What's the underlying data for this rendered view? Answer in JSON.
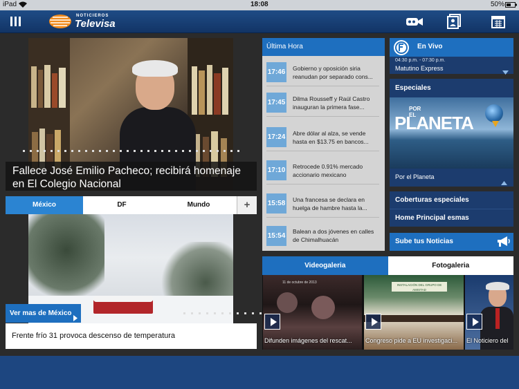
{
  "status": {
    "carrier": "iPad",
    "time": "18:08",
    "battery": "50%"
  },
  "brand": {
    "line1": "NOTICIEROS",
    "line2": "Televisa"
  },
  "hero": {
    "title": "Fallece José Emilio Pacheco; recibirá homenaje en El Colegio Nacional"
  },
  "sections": {
    "tabs": [
      "México",
      "DF",
      "Mundo"
    ],
    "add": "+"
  },
  "mexico": {
    "more": "Ver mas de México",
    "story": "Frente frío 31 provoca descenso de temperatura"
  },
  "ultima": {
    "title": "Última Hora",
    "items": [
      {
        "time": "17:46",
        "text": "Gobierno y oposición siria reanudan por separado cons..."
      },
      {
        "time": "17:45",
        "text": "Dilma Rousseff y Raúl Castro inauguran la primera fase..."
      },
      {
        "time": "17:24",
        "text": "Abre dólar al alza, se vende hasta en $13.75 en bancos..."
      },
      {
        "time": "17:10",
        "text": "Retrocede 0.91% mercado accionario mexicano"
      },
      {
        "time": "15:58",
        "text": "Una francesa se declara en huelga de hambre hasta la..."
      },
      {
        "time": "15:54",
        "text": "Balean a dos jóvenes en calles de Chimalhuacán"
      }
    ]
  },
  "envivo": {
    "label": "En Vivo",
    "schedule": "04:30 p.m. - 07:30 p.m.",
    "program": "Matutino Express"
  },
  "especiales": {
    "label": "Especiales",
    "banner_small": "POR EL",
    "banner_big": "PLANETA",
    "caption": "Por el Planeta"
  },
  "links": {
    "coberturas": "Coberturas especiales",
    "home": "Home Principal esmas",
    "sube": "Sube tus Noticias"
  },
  "gallery": {
    "tabs": [
      "Videogaleria",
      "Fotogaleria"
    ],
    "items": [
      {
        "caption": "Difunden imágenes del rescat...",
        "stamp": "11 de octubre de 2013"
      },
      {
        "caption": "Congreso pide a EU investigaci...",
        "stamp": "INSTALACIÓN DEL GRUPO DE AMISTAD"
      },
      {
        "caption": "El Noticiero del"
      }
    ]
  },
  "colors": {
    "accent": "#1e6fbf",
    "topbar": "#1f4c86",
    "time_badge": "#6fa8d8"
  },
  "icons": [
    "menu-icon",
    "video-camera-icon",
    "contacts-icon",
    "calendar-icon",
    "megaphone-icon",
    "play-icon"
  ]
}
